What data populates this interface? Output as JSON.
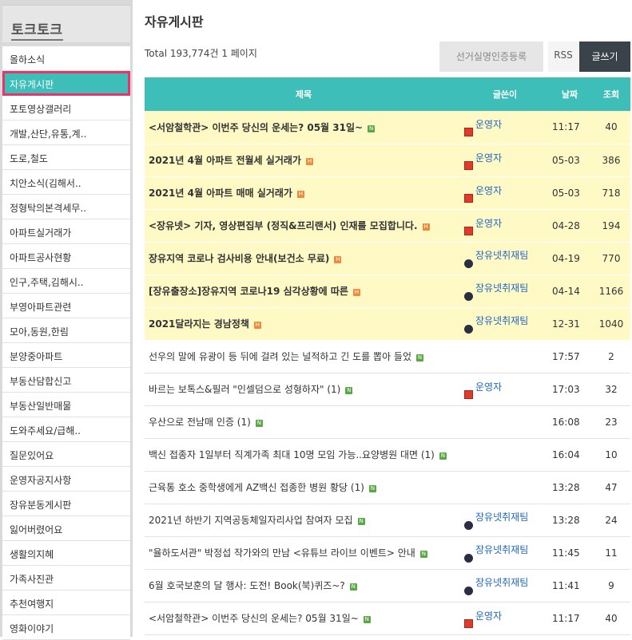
{
  "sidebar": {
    "title": "토크토크",
    "items": [
      {
        "label": "올하소식"
      },
      {
        "label": "자유게시판",
        "active": true
      },
      {
        "label": "포토영상갤러리"
      },
      {
        "label": "개발,산단,유통,계.."
      },
      {
        "label": "도로,철도"
      },
      {
        "label": "치안소식(김해서.."
      },
      {
        "label": "정형탁의본격세무.."
      },
      {
        "label": "아파트실거래가"
      },
      {
        "label": "아파트공사현황"
      },
      {
        "label": "인구,주택,김해시.."
      },
      {
        "label": "부영아파트관련"
      },
      {
        "label": "모아,동원,한림"
      },
      {
        "label": "분양중아파트"
      },
      {
        "label": "부동산담합신고"
      },
      {
        "label": "부동산일반매물"
      },
      {
        "label": "도와주세요/급해.."
      },
      {
        "label": "질문있어요"
      },
      {
        "label": "운영자공지사항"
      },
      {
        "label": "장유분동게시판"
      },
      {
        "label": "잃어버렸어요"
      },
      {
        "label": "생활의지혜"
      },
      {
        "label": "가족사진관"
      },
      {
        "label": "추천여행지"
      },
      {
        "label": "영화이야기"
      }
    ]
  },
  "main": {
    "title": "자유게시판",
    "total": "Total 193,774건 1 페이지",
    "buttons": {
      "verify": "선거실명인증등록",
      "rss": "RSS",
      "write": "글쓰기"
    }
  },
  "table": {
    "headers": {
      "title": "제목",
      "author": "글쓴이",
      "date": "날짜",
      "views": "조회"
    },
    "rows": [
      {
        "title": "<서암철학관> 이번주 당신의 운세는? 05월 31일~",
        "author": "운영자",
        "author_mark": "red",
        "date": "11:17",
        "views": "40",
        "notice": true,
        "badge": "N"
      },
      {
        "title": "2021년 4월 아파트 전월세 실거래가",
        "author": "운영자",
        "author_mark": "red",
        "date": "05-03",
        "views": "386",
        "notice": true,
        "badge": "H"
      },
      {
        "title": "2021년 4월 아파트 매매 실거래가",
        "author": "운영자",
        "author_mark": "red",
        "date": "05-03",
        "views": "718",
        "notice": true,
        "badge": "H"
      },
      {
        "title": "<장유넷> 기자, 영상편집부 (정직&프리랜서) 인재를 모집합니다.",
        "author": "운영자",
        "author_mark": "red",
        "date": "04-28",
        "views": "194",
        "notice": true,
        "badge": "H"
      },
      {
        "title": "장유지역 코로나 검사비용 안내(보건소 무료)",
        "author": "장유넷취재팀",
        "author_mark": "dot",
        "date": "04-19",
        "views": "770",
        "notice": true,
        "badge": "H"
      },
      {
        "title": "[장유출장소]장유지역 코로나19 심각상황에 따른",
        "author": "장유넷취재팀",
        "author_mark": "dot",
        "date": "04-14",
        "views": "1166",
        "notice": true,
        "badge": "H"
      },
      {
        "title": "2021달라지는 경남정책",
        "author": "장유넷취재팀",
        "author_mark": "dot",
        "date": "12-31",
        "views": "1040",
        "notice": true,
        "badge": "H"
      },
      {
        "title": "선우의 말에 유광이 등 뒤에 걸려 있는 널적하고 긴 도를 뽑아 들었",
        "author": "",
        "author_mark": "",
        "date": "17:57",
        "views": "2",
        "notice": false,
        "badge": "N"
      },
      {
        "title": "바르는 보톡스&필러 \"인셀덤으로 성형하자\" (1)",
        "author": "운영자",
        "author_mark": "red",
        "date": "17:03",
        "views": "32",
        "notice": false,
        "badge": "N"
      },
      {
        "title": "우산으로 전남매 인증 (1)",
        "author": "",
        "author_mark": "",
        "date": "16:08",
        "views": "23",
        "notice": false,
        "badge": "N"
      },
      {
        "title": "백신 접종자 1일부터 직계가족 최대 10명 모임 가능..요양병원 대면 (1)",
        "author": "",
        "author_mark": "",
        "date": "16:04",
        "views": "10",
        "notice": false,
        "badge": "N"
      },
      {
        "title": "근육통 호소 중학생에게 AZ백신 접종한 병원 황당 (1)",
        "author": "",
        "author_mark": "",
        "date": "13:28",
        "views": "47",
        "notice": false,
        "badge": "N"
      },
      {
        "title": "2021년 하반기 지역공동체일자리사업 참여자 모집",
        "author": "장유넷취재팀",
        "author_mark": "dot",
        "date": "13:28",
        "views": "24",
        "notice": false,
        "badge": "N"
      },
      {
        "title": "\"율하도서관\" 박정섭 작가와의 만남 <유튜브 라이브 이벤트> 안내",
        "author": "장유넷취재팀",
        "author_mark": "dot",
        "date": "11:45",
        "views": "11",
        "notice": false,
        "badge": "N"
      },
      {
        "title": "6월 호국보훈의 달 행사: 도전! Book(북)퀴즈~?",
        "author": "장유넷취재팀",
        "author_mark": "dot",
        "date": "11:41",
        "views": "9",
        "notice": false,
        "badge": "N"
      },
      {
        "title": "<서암철학관> 이번주 당신의 운세는? 05월 31일~",
        "author": "운영자",
        "author_mark": "red",
        "date": "11:17",
        "views": "40",
        "notice": false,
        "badge": "N"
      }
    ]
  }
}
